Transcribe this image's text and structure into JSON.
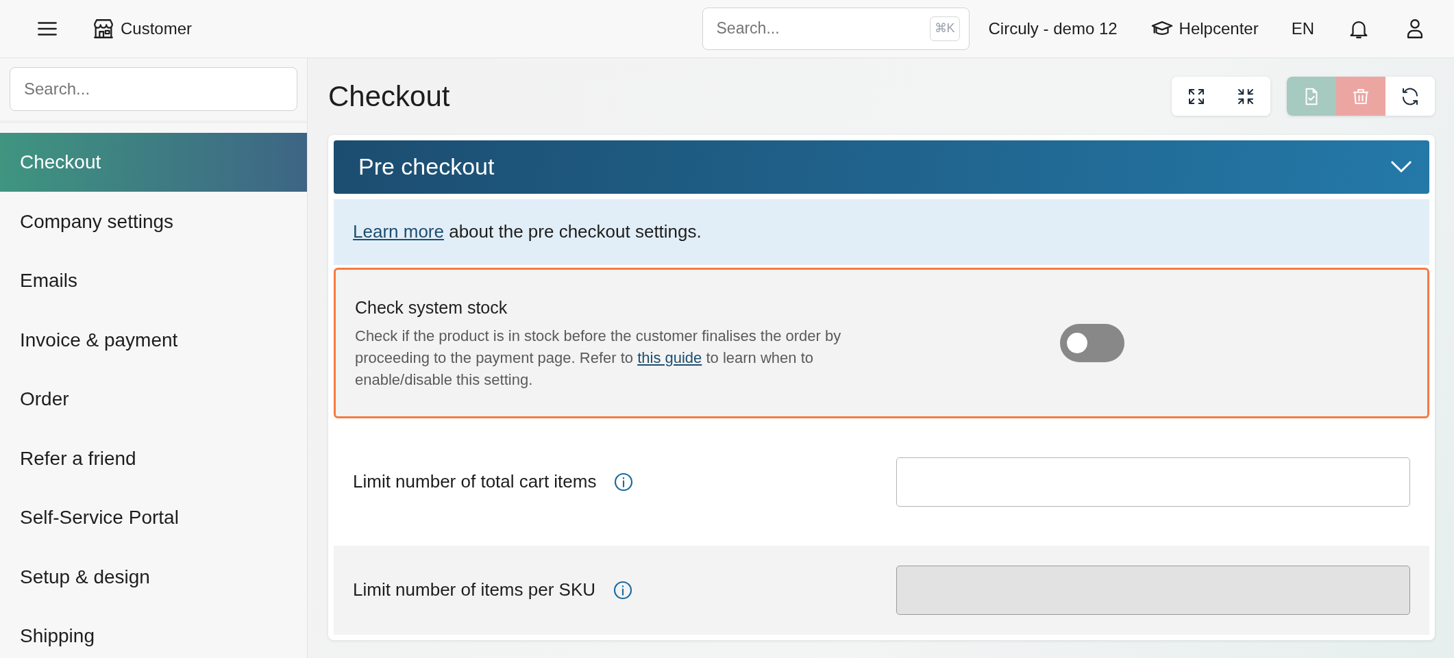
{
  "topbar": {
    "module": "Customer",
    "search": {
      "placeholder": "Search...",
      "shortcut": "⌘K"
    },
    "account": "Circuly - demo 12",
    "help": "Helpcenter",
    "language": "EN"
  },
  "sidebar": {
    "search": {
      "placeholder": "Search..."
    },
    "items": [
      {
        "label": "Checkout",
        "selected": true
      },
      {
        "label": "Company settings",
        "selected": false
      },
      {
        "label": "Emails",
        "selected": false
      },
      {
        "label": "Invoice & payment",
        "selected": false
      },
      {
        "label": "Order",
        "selected": false
      },
      {
        "label": "Refer a friend",
        "selected": false
      },
      {
        "label": "Self-Service Portal",
        "selected": false
      },
      {
        "label": "Setup & design",
        "selected": false
      },
      {
        "label": "Shipping",
        "selected": false
      }
    ]
  },
  "page": {
    "title": "Checkout"
  },
  "toolbar": [
    [
      {
        "kind": "expand",
        "disabled": false
      },
      {
        "kind": "collapse",
        "disabled": false
      }
    ],
    [
      {
        "kind": "save",
        "disabled": true
      },
      {
        "kind": "delete",
        "disabled": true
      },
      {
        "kind": "refresh",
        "disabled": false
      }
    ]
  ],
  "section": {
    "title": "Pre checkout",
    "expanded": true,
    "info": {
      "link": "Learn more",
      "text": "about the pre checkout settings."
    },
    "settings": [
      {
        "kind": "toggle",
        "title": "Check system stock",
        "description": {
          "before": "Check if the product is in stock before the customer finalises the order by proceeding to the payment page. Refer to",
          "link": "this guide",
          "after": "to learn when to enable/disable this setting."
        },
        "on": false,
        "highlighted": true
      },
      {
        "kind": "number",
        "label": "Limit number of total cart items",
        "disabled": false,
        "highlighted": false
      },
      {
        "kind": "number",
        "label": "Limit number of items per SKU",
        "disabled": true,
        "highlighted": false
      }
    ]
  }
}
